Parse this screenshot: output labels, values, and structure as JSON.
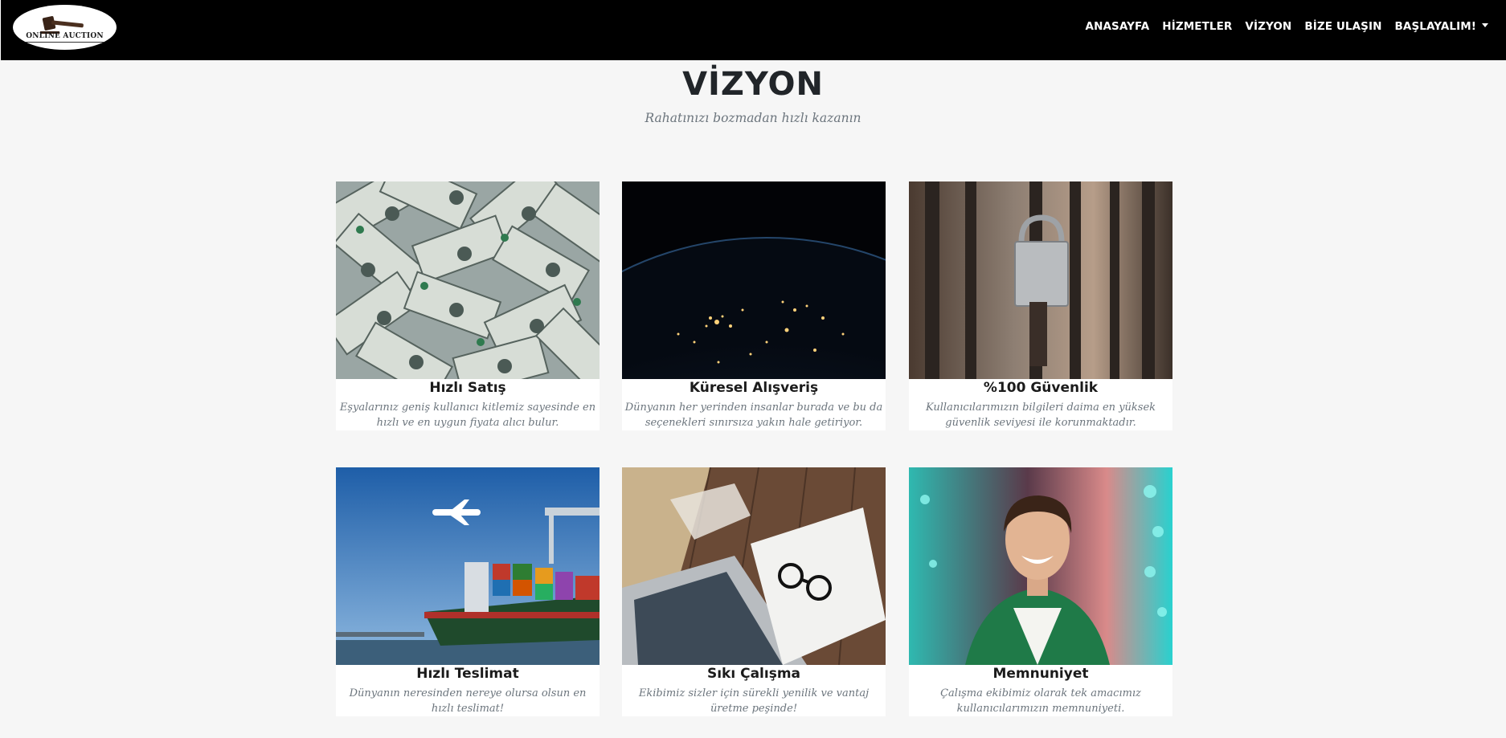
{
  "logo": {
    "text": "ONLINE AUCTION"
  },
  "nav": {
    "items": [
      "ANASAYFA",
      "HİZMETLER",
      "VİZYON",
      "BİZE ULAŞIN"
    ],
    "dropdown": "BAŞLAYALIM!"
  },
  "section": {
    "title": "VİZYON",
    "subtitle": "Rahatınızı bozmadan hızlı kazanın"
  },
  "cards": [
    {
      "title": "Hızlı Satış",
      "text": "Eşyalarınız geniş kullanıcı kitlemiz sayesinde en hızlı ve en uygun fiyata alıcı bulur.",
      "image": "dollar-bills-photo"
    },
    {
      "title": "Küresel Alışveriş",
      "text": "Dünyanın her yerinden insanlar burada ve bu da seçenekleri sınırsıza yakın hale getiriyor.",
      "image": "earth-at-night-photo"
    },
    {
      "title": "%100 Güvenlik",
      "text": "Kullanıcılarımızın bilgileri daima en yüksek güvenlik seviyesi ile korunmaktadır.",
      "image": "padlock-photo"
    },
    {
      "title": "Hızlı Teslimat",
      "text": "Dünyanın neresinden nereye olursa olsun en hızlı teslimat!",
      "image": "cargo-ship-airplane-photo"
    },
    {
      "title": "Sıkı Çalışma",
      "text": "Ekibimiz sizler için sürekli yenilik ve vantaj üretme peşinde!",
      "image": "laptop-notebook-glasses-photo"
    },
    {
      "title": "Memnuniyet",
      "text": "Çalışma ekibimiz olarak tek amacımız kullanıcılarımızın memnuniyeti.",
      "image": "smiling-man-photo"
    }
  ]
}
